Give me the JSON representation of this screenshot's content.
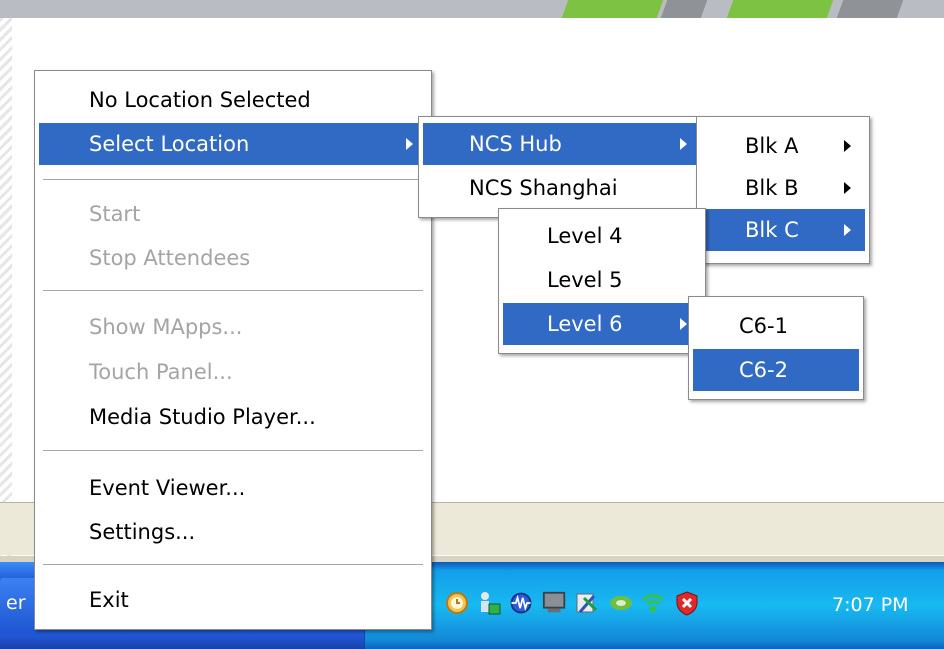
{
  "main_menu": {
    "items": [
      {
        "label": "No Location Selected",
        "state": "normal"
      },
      {
        "label": "Select Location",
        "state": "selected",
        "submenu": true
      },
      {
        "label": "Start",
        "state": "disabled"
      },
      {
        "label": "Stop Attendees",
        "state": "disabled"
      },
      {
        "label": "Show MApps...",
        "state": "disabled"
      },
      {
        "label": "Touch Panel...",
        "state": "disabled"
      },
      {
        "label": "Media Studio Player...",
        "state": "normal"
      },
      {
        "label": "Event Viewer...",
        "state": "normal"
      },
      {
        "label": "Settings...",
        "state": "normal"
      },
      {
        "label": "Exit",
        "state": "normal"
      }
    ]
  },
  "location_menu": {
    "items": [
      {
        "label": "NCS Hub",
        "state": "selected",
        "submenu": true
      },
      {
        "label": "NCS Shanghai",
        "state": "normal"
      }
    ]
  },
  "block_menu": {
    "items": [
      {
        "label": "Blk A",
        "state": "normal",
        "submenu": true
      },
      {
        "label": "Blk B",
        "state": "normal",
        "submenu": true
      },
      {
        "label": "Blk C",
        "state": "selected",
        "submenu": true
      }
    ]
  },
  "level_menu": {
    "items": [
      {
        "label": "Level 4",
        "state": "normal"
      },
      {
        "label": "Level 5",
        "state": "normal"
      },
      {
        "label": "Level 6",
        "state": "selected",
        "submenu": true
      }
    ]
  },
  "room_menu": {
    "items": [
      {
        "label": "C6-1",
        "state": "normal"
      },
      {
        "label": "C6-2",
        "state": "selected"
      }
    ]
  },
  "taskbar": {
    "task_button_label": "er",
    "clock": "7:07 PM",
    "tray_icons": [
      "clock-icon",
      "network-user-icon",
      "audio-wave-icon",
      "monitor-icon",
      "tools-icon",
      "nvidia-icon",
      "wireless-icon",
      "security-shield-icon"
    ]
  },
  "colors": {
    "highlight": "#316ac5",
    "taskbar": "#245edb",
    "tray": "#18b9f1"
  }
}
